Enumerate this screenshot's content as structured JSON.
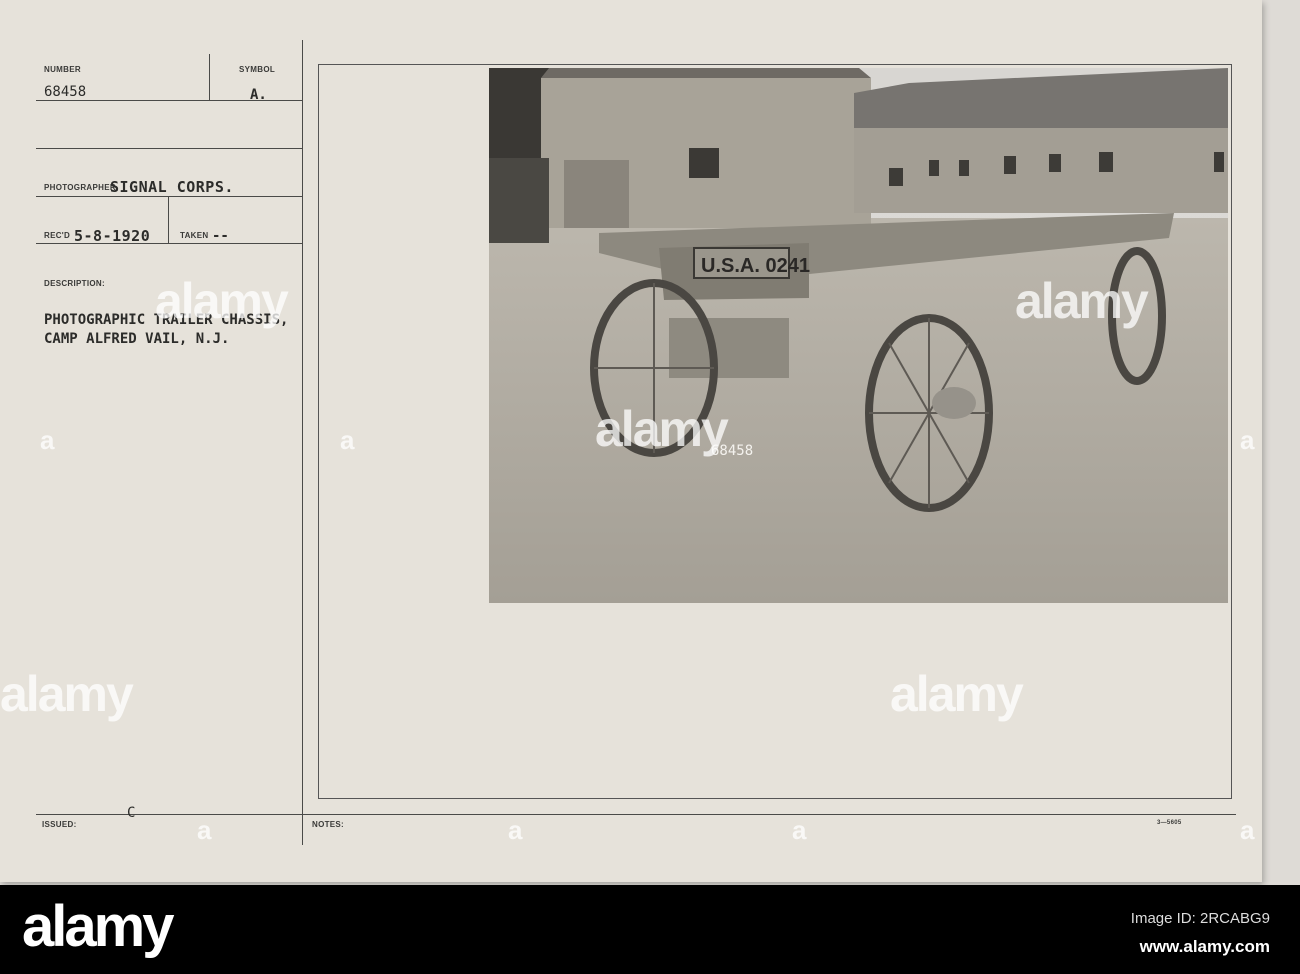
{
  "card": {
    "number_label": "NUMBER",
    "number_value": "68458",
    "symbol_label": "SYMBOL",
    "symbol_value": "A.",
    "photographer_label": "PHOTOGRAPHER",
    "photographer_value": "SIGNAL CORPS.",
    "recd_label": "REC'D",
    "recd_value": "5-8-1920",
    "taken_label": "TAKEN",
    "taken_value": "--",
    "description_label": "DESCRIPTION:",
    "description_lines": [
      "PHOTOGRAPHIC TRAILER CHASSIS,",
      "CAMP ALFRED VAIL, N.J."
    ],
    "issued_label": "ISSUED:",
    "issued_value": "C",
    "notes_label": "NOTES:",
    "form_number": "3—5605"
  },
  "photo": {
    "trailer_plate": "U.S.A. 0241",
    "negative_number": "68458"
  },
  "watermark": {
    "text": "alamy",
    "letter": "a"
  },
  "footer": {
    "logo": "alamy",
    "image_id": "Image ID: 2RCABG9",
    "site": "www.alamy.com"
  },
  "colors": {
    "paper": "#e6e2da",
    "ink": "#2c2c2a",
    "footer": "#000000"
  }
}
